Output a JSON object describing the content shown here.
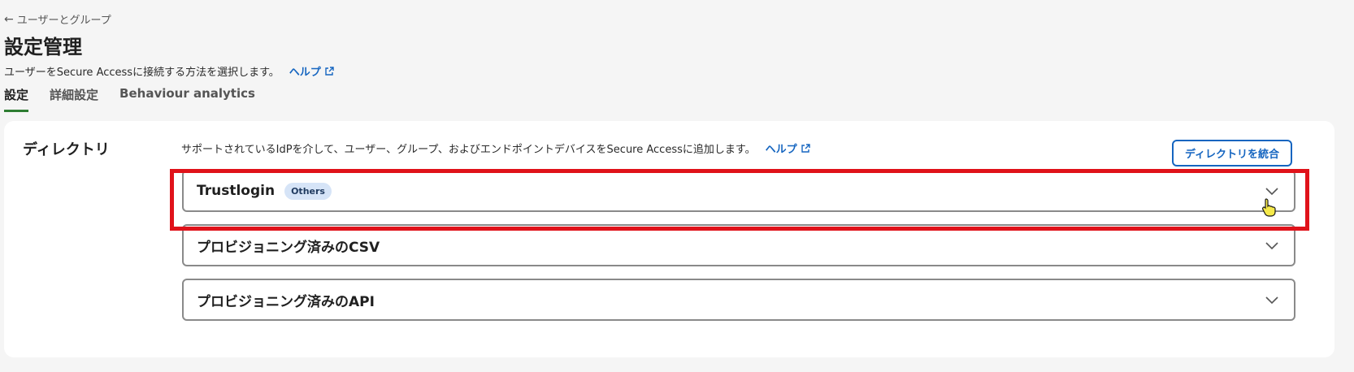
{
  "breadcrumb": {
    "back_label": "ユーザーとグループ"
  },
  "page": {
    "title": "設定管理",
    "subtitle": "ユーザーをSecure Accessに接続する方法を選択します。",
    "help_label": "ヘルプ"
  },
  "tabs": [
    {
      "label": "設定",
      "active": true
    },
    {
      "label": "詳細設定",
      "active": false
    },
    {
      "label": "Behaviour analytics",
      "active": false
    }
  ],
  "directory": {
    "section_label": "ディレクトリ",
    "description": "サポートされているIdPを介して、ユーザー、グループ、およびエンドポイントデバイスをSecure Accessに追加します。",
    "help_label": "ヘルプ",
    "integrate_button": "ディレクトリを統合",
    "items": [
      {
        "name": "Trustlogin",
        "badge": "Others",
        "expanded": false,
        "highlighted": true
      },
      {
        "name": "プロビジョニング済みのCSV",
        "badge": null,
        "expanded": false
      },
      {
        "name": "プロビジョニング済みのAPI",
        "badge": null,
        "expanded": false
      }
    ]
  },
  "colors": {
    "accent": "#1565c0",
    "active_tab_underline": "#2e7d32",
    "highlight": "#e0121a",
    "badge_bg": "#d6e4f7"
  },
  "icons": {
    "back": "arrow-left-icon",
    "external": "external-link-icon",
    "expand": "chevron-down-icon",
    "cursor": "hand-pointer-icon"
  }
}
